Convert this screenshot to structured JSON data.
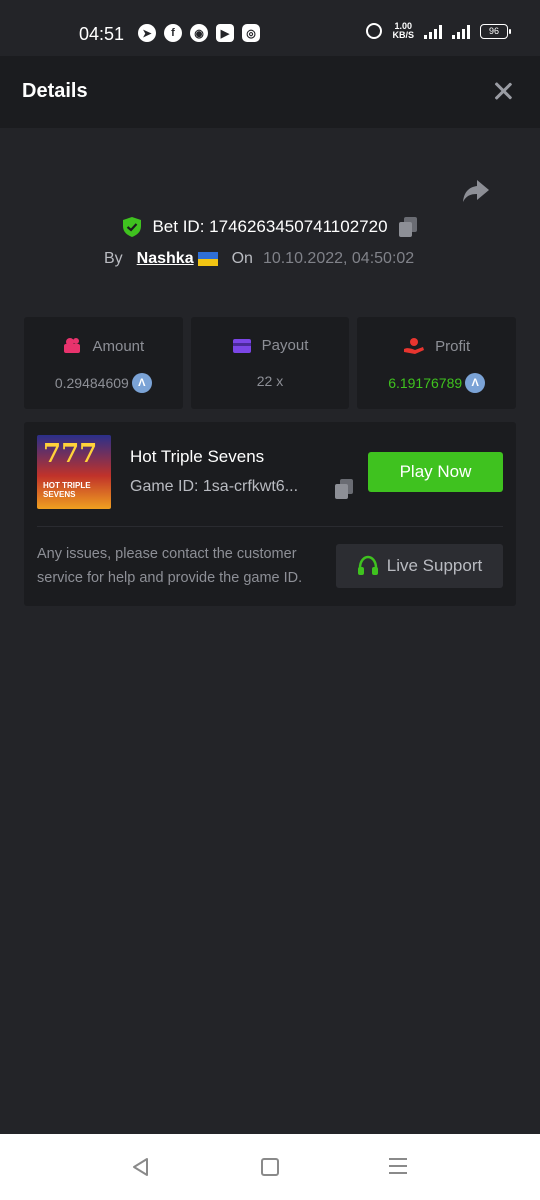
{
  "status_bar": {
    "time": "04:51",
    "apps": [
      "telegram-icon",
      "facebook-icon",
      "signal-icon",
      "youtube-icon",
      "instagram-icon"
    ],
    "speed_value": "1.00",
    "speed_unit": "KB/S",
    "battery": "96"
  },
  "header": {
    "title": "Details"
  },
  "bet": {
    "id_text": "Bet ID: 1746263450741102720",
    "by_label": "By",
    "user": "Nashka",
    "on_label": "On",
    "date": "10.10.2022, 04:50:02"
  },
  "stats": {
    "amount_label": "Amount",
    "amount_value": "0.29484609",
    "payout_label": "Payout",
    "payout_value": "22 x",
    "profit_label": "Profit",
    "profit_value": "6.19176789"
  },
  "game": {
    "title": "Hot Triple Sevens",
    "id_text": "Game ID: 1sa-crfkwt6...",
    "play_label": "Play Now",
    "thumb_top": "777",
    "thumb_bottom": "HOT TRIPLE SEVENS",
    "support_text": "Any issues, please contact the customer service for help and provide the game ID.",
    "support_label": "Live Support"
  },
  "colors": {
    "background": "#232428",
    "card": "#1b1c1f",
    "accent_green": "#3fc21f",
    "amount_icon": "#e8336d",
    "payout_icon": "#7b46e6",
    "profit_icon": "#e8352f",
    "coin": "#7ba3d6"
  }
}
